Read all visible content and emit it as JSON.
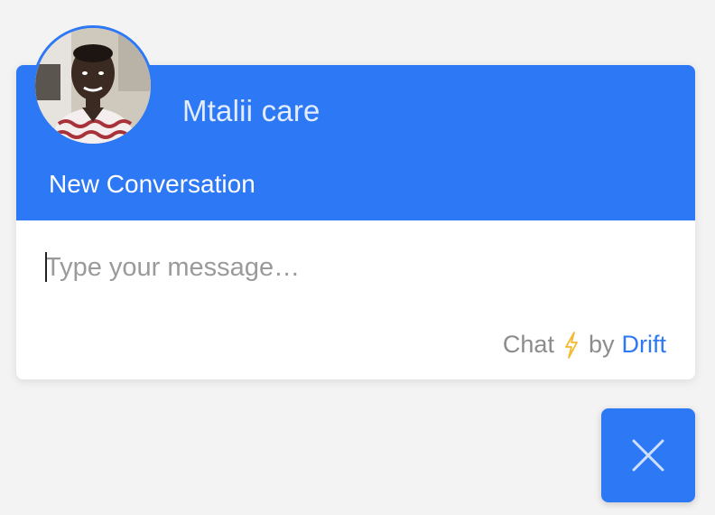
{
  "header": {
    "agent_name": "Mtalii care",
    "conversation_title": "New Conversation",
    "background_color": "#2d78f4"
  },
  "composer": {
    "placeholder": "Type your message…"
  },
  "branding": {
    "chat_label": "Chat",
    "by_label": "by",
    "brand_name": "Drift",
    "icon": "lightning-bolt-icon",
    "brand_color": "#2d78f4",
    "bolt_color": "#f5b82e"
  },
  "close_button": {
    "icon": "close-icon",
    "background_color": "#2d78f4"
  },
  "avatar": {
    "icon": "agent-avatar"
  }
}
